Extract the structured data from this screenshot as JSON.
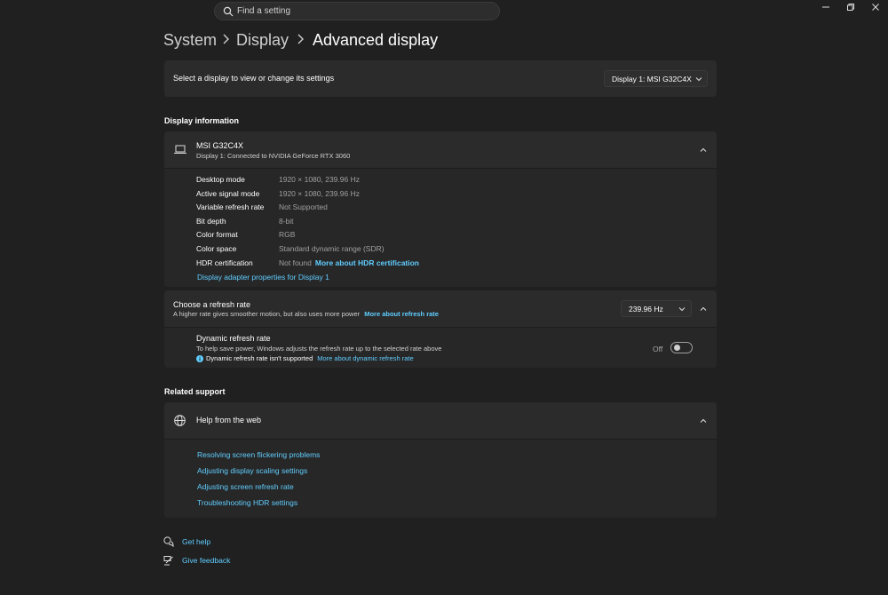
{
  "search": {
    "placeholder": "Find a setting"
  },
  "breadcrumb": {
    "items": [
      "System",
      "Display",
      "Advanced display"
    ]
  },
  "display_select": {
    "label": "Select a display to view or change its settings",
    "selected": "Display 1: MSI G32C4X"
  },
  "display_information": {
    "section_title": "Display information",
    "monitor_name": "MSI G32C4X",
    "monitor_subtitle": "Display 1: Connected to NVIDIA GeForce RTX 3060",
    "rows": [
      {
        "label": "Desktop mode",
        "value": "1920 × 1080, 239.96 Hz"
      },
      {
        "label": "Active signal mode",
        "value": "1920 × 1080, 239.96 Hz"
      },
      {
        "label": "Variable refresh rate",
        "value": "Not Supported"
      },
      {
        "label": "Bit depth",
        "value": "8-bit"
      },
      {
        "label": "Color format",
        "value": "RGB"
      },
      {
        "label": "Color space",
        "value": "Standard dynamic range (SDR)"
      },
      {
        "label": "HDR certification",
        "value": "Not found"
      }
    ],
    "hdr_link": "More about HDR certification",
    "adapter_link": "Display adapter properties for Display 1"
  },
  "refresh_rate": {
    "title": "Choose a refresh rate",
    "description": "A higher rate gives smoother motion, but also uses more power",
    "link": "More about refresh rate",
    "selected": "239.96 Hz",
    "dynamic": {
      "title": "Dynamic refresh rate",
      "description": "To help save power, Windows adjusts the refresh rate up to the selected rate above",
      "warning": "Dynamic refresh rate isn't supported",
      "link": "More about dynamic refresh rate",
      "toggle_state": "Off"
    }
  },
  "related_support": {
    "section_title": "Related support",
    "help_title": "Help from the web",
    "links": [
      "Resolving screen flickering problems",
      "Adjusting display scaling settings",
      "Adjusting screen refresh rate",
      "Troubleshooting HDR settings"
    ]
  },
  "footer": {
    "get_help": "Get help",
    "give_feedback": "Give feedback"
  },
  "colors": {
    "background": "#202020",
    "card": "#2b2b2b",
    "accent_link": "#60cdff",
    "info_icon": "#60cdff"
  }
}
